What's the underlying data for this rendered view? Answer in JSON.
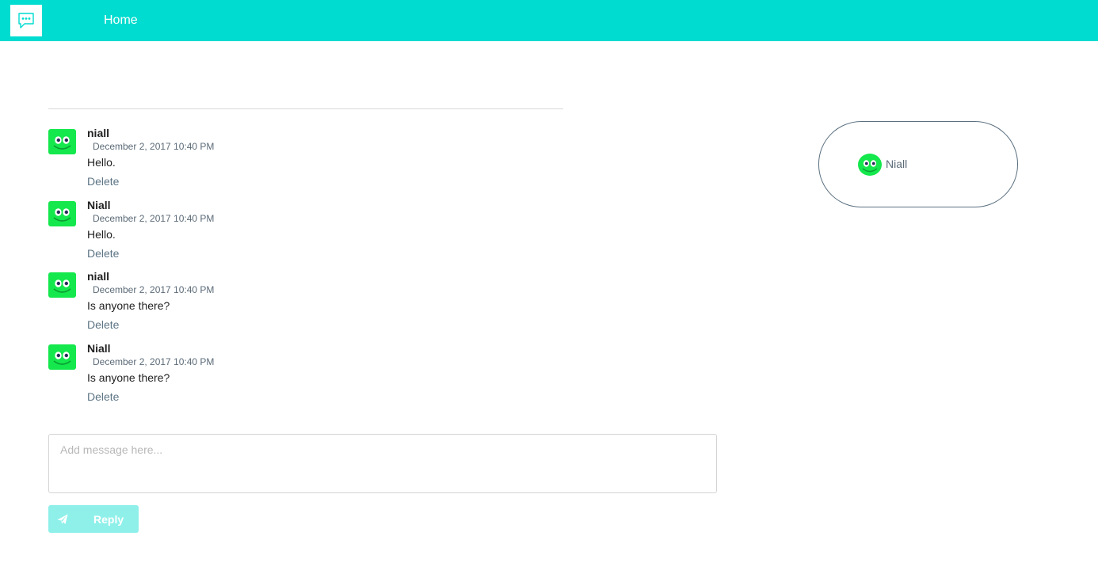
{
  "header": {
    "logo_icon": "chat-bubble-icon",
    "home_label": "Home",
    "background_color": "#00dccf"
  },
  "messages": [
    {
      "author": "niall",
      "timestamp": "December 2, 2017 10:40 PM",
      "text": "Hello.",
      "delete_label": "Delete",
      "avatar_icon": "smiley-avatar-icon"
    },
    {
      "author": "Niall",
      "timestamp": "December 2, 2017 10:40 PM",
      "text": "Hello.",
      "delete_label": "Delete",
      "avatar_icon": "smiley-avatar-icon"
    },
    {
      "author": "niall",
      "timestamp": "December 2, 2017 10:40 PM",
      "text": "Is anyone there?",
      "delete_label": "Delete",
      "avatar_icon": "smiley-avatar-icon"
    },
    {
      "author": "Niall",
      "timestamp": "December 2, 2017 10:40 PM",
      "text": "Is anyone there?",
      "delete_label": "Delete",
      "avatar_icon": "smiley-avatar-icon"
    }
  ],
  "composer": {
    "placeholder": "Add message here...",
    "value": "",
    "reply_label": "Reply",
    "reply_icon": "paper-plane-icon",
    "reply_color": "#8ff0ea"
  },
  "users_panel": {
    "users": [
      {
        "name": "Niall",
        "avatar_icon": "smiley-avatar-icon"
      }
    ]
  },
  "colors": {
    "avatar_green": "#14e84c"
  }
}
